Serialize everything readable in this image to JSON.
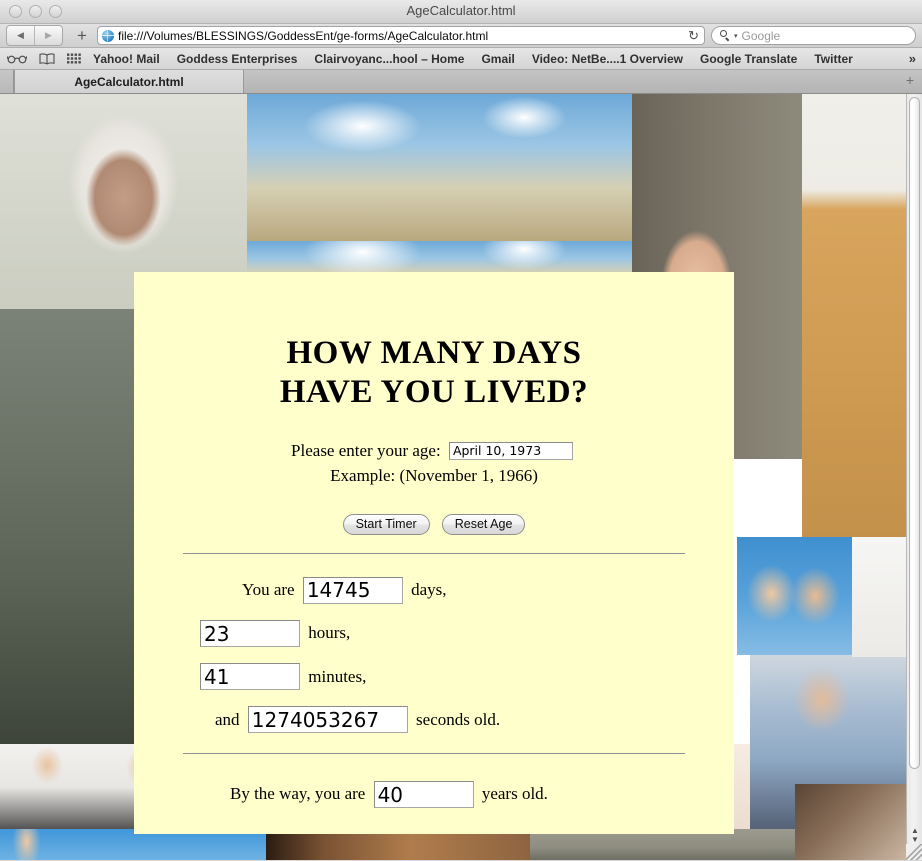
{
  "window": {
    "title": "AgeCalculator.html",
    "traffic_lights": [
      "close",
      "minimize",
      "zoom"
    ]
  },
  "toolbar": {
    "back_label": "◀",
    "forward_label": "▶",
    "add_tab_label": "+",
    "url": "file:///Volumes/BLESSINGS/GoddessEnt/ge-forms/AgeCalculator.html",
    "reload_label": "↻",
    "search_placeholder": "Google"
  },
  "bookmarks": {
    "items": [
      {
        "label": "Yahoo! Mail"
      },
      {
        "label": "Goddess Enterprises"
      },
      {
        "label": "Clairvoyanc...hool – Home"
      },
      {
        "label": "Gmail"
      },
      {
        "label": "Video: NetBe....1 Overview"
      },
      {
        "label": "Google Translate"
      },
      {
        "label": "Twitter"
      }
    ],
    "overflow_label": "»"
  },
  "tabs": {
    "items": [
      {
        "label": "AgeCalculator.html",
        "active": true
      }
    ],
    "new_tab_label": "+"
  },
  "page": {
    "headline_line1": "HOW MANY DAYS",
    "headline_line2": "HAVE YOU LIVED?",
    "age_prompt": "Please enter your age:",
    "age_value": "April 10, 1973",
    "age_placeholder": "",
    "example_text": "Example: (November 1, 1966)",
    "start_button": "Start Timer",
    "reset_button": "Reset Age",
    "results": {
      "days_prefix": "You are",
      "days_value": "14745",
      "days_suffix": "days,",
      "hours_value": "23",
      "hours_suffix": "hours,",
      "minutes_value": "41",
      "minutes_suffix": "minutes,",
      "seconds_prefix": "and",
      "seconds_value": "1274053267",
      "seconds_suffix": "seconds old."
    },
    "byway_prefix": "By the way, you are",
    "byway_value": "40",
    "byway_suffix": "years old.",
    "card_background": "#ffffcc",
    "rule_color": "#8f8f96"
  },
  "scrollbar": {
    "up_arrow": "▲",
    "down_arrow": "▼"
  },
  "collage": {
    "description": "Background photo collage of people of many ages",
    "tiles": [
      {
        "name": "elderly-woman-headscarf"
      },
      {
        "name": "children-under-sky"
      },
      {
        "name": "smiling-woman-profile"
      },
      {
        "name": "toddler-in-desert"
      },
      {
        "name": "woman-in-sweater-on-rocks"
      },
      {
        "name": "two-women-blue-sky"
      },
      {
        "name": "older-man-blue-shirt"
      },
      {
        "name": "two-women-in-dresses"
      },
      {
        "name": "baby-in-striped-bib"
      },
      {
        "name": "baby-neck-closeup"
      },
      {
        "name": "blurred-hair"
      },
      {
        "name": "arms-against-blue-sky"
      },
      {
        "name": "wooden-texture"
      },
      {
        "name": "man-face"
      }
    ]
  }
}
